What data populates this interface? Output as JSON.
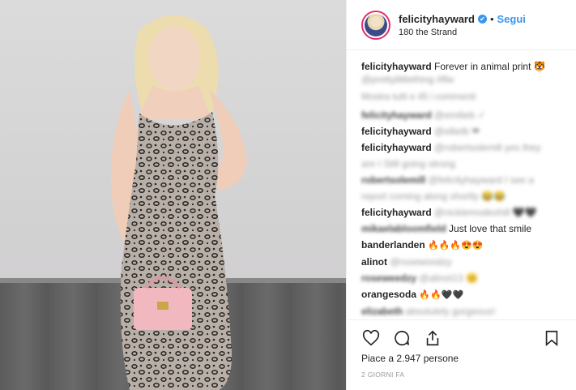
{
  "post": {
    "username": "felicityhayward",
    "verified_glyph": "✔",
    "dot": "•",
    "follow_label": "Segui",
    "location": "180 the Strand"
  },
  "caption": {
    "username": "felicityhayward",
    "text": "Forever in animal print 🐯",
    "tag": "@prettylittlething #lfw"
  },
  "comments_more": "Mostra tutti e 45 i commenti",
  "comments": [
    {
      "name": "felicityhayward",
      "text": "@emilieb ✓"
    },
    {
      "name": "felicityhayward",
      "text": "@ellielb ❤"
    },
    {
      "name": "felicityhayward",
      "text": "@robertsolemill yes they",
      "text2": "are I Still going strong"
    },
    {
      "name": "robertsolemill",
      "text": "@felicityhayward I see a",
      "text2": "report coming along shortly 😂😂"
    },
    {
      "name": "felicityhayward",
      "text": "@nicklemodeshill 🖤🖤"
    },
    {
      "name": "mikaelabloomfield",
      "text": "Just love that smile"
    },
    {
      "name": "banderlanden",
      "text": "🔥🔥🔥😍😍"
    },
    {
      "name": "alinot",
      "text": "@rosewoodzy"
    },
    {
      "name": "roseweedzy",
      "text": "@alinot13 😊"
    },
    {
      "name": "orangesoda",
      "text": "🔥🔥🖤🖤"
    },
    {
      "name": "elizabeth",
      "text": "absolutely gorgeous!"
    }
  ],
  "icons": {
    "like": "heart-icon",
    "comment": "comment-bubble-icon",
    "share": "share-upload-icon",
    "save": "bookmark-icon"
  },
  "likes_text": "Piace a 2.947 persone",
  "timestamp": "2 GIORNI FA"
}
